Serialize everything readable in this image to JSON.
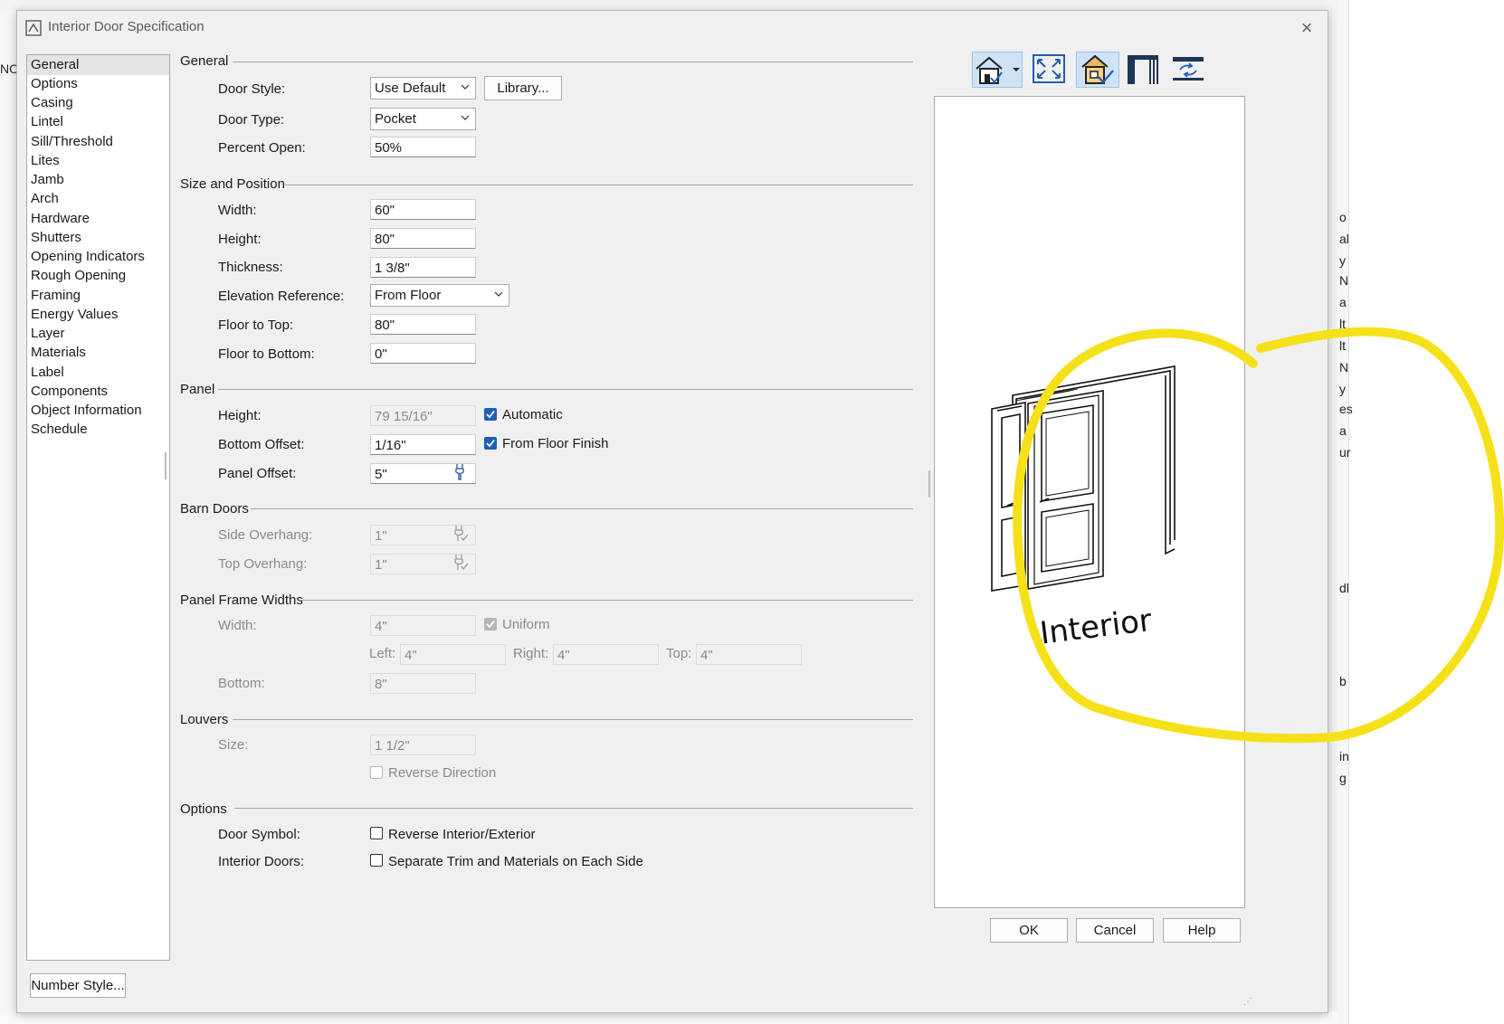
{
  "dialog": {
    "title": "Interior Door Specification",
    "close_glyph": "×"
  },
  "nav": {
    "items": [
      "General",
      "Options",
      "Casing",
      "Lintel",
      "Sill/Threshold",
      "Lites",
      "Jamb",
      "Arch",
      "Hardware",
      "Shutters",
      "Opening Indicators",
      "Rough Opening",
      "Framing",
      "Energy Values",
      "Layer",
      "Materials",
      "Label",
      "Components",
      "Object Information",
      "Schedule"
    ],
    "selected": "General"
  },
  "general": {
    "heading": "General",
    "door_style_label": "Door Style:",
    "door_style_value": "Use Default",
    "library_button": "Library...",
    "door_type_label": "Door Type:",
    "door_type_value": "Pocket",
    "percent_open_label": "Percent Open:",
    "percent_open_value": "50%"
  },
  "size_position": {
    "heading": "Size and Position",
    "width_label": "Width:",
    "width_value": "60\"",
    "height_label": "Height:",
    "height_value": "80\"",
    "thickness_label": "Thickness:",
    "thickness_value": "1 3/8\"",
    "elev_ref_label": "Elevation Reference:",
    "elev_ref_value": "From Floor",
    "floor_top_label": "Floor to Top:",
    "floor_top_value": "80\"",
    "floor_bottom_label": "Floor to Bottom:",
    "floor_bottom_value": "0\""
  },
  "panel": {
    "heading": "Panel",
    "height_label": "Height:",
    "height_value": "79 15/16\"",
    "automatic_label": "Automatic",
    "automatic_checked": true,
    "bottom_offset_label": "Bottom Offset:",
    "bottom_offset_value": "1/16\"",
    "from_floor_finish_label": "From Floor Finish",
    "from_floor_finish_checked": true,
    "panel_offset_label": "Panel Offset:",
    "panel_offset_value": "5\""
  },
  "barn_doors": {
    "heading": "Barn Doors",
    "side_overhang_label": "Side Overhang:",
    "side_overhang_value": "1\"",
    "top_overhang_label": "Top Overhang:",
    "top_overhang_value": "1\""
  },
  "panel_frame": {
    "heading": "Panel Frame Widths",
    "width_label": "Width:",
    "width_value": "4\"",
    "uniform_label": "Uniform",
    "uniform_checked": true,
    "left_label": "Left:",
    "left_value": "4\"",
    "right_label": "Right:",
    "right_value": "4\"",
    "top_label": "Top:",
    "top_value": "4\"",
    "bottom_label": "Bottom:",
    "bottom_value": "8\""
  },
  "louvers": {
    "heading": "Louvers",
    "size_label": "Size:",
    "size_value": "1 1/2\"",
    "reverse_label": "Reverse Direction",
    "reverse_checked": false
  },
  "options": {
    "heading": "Options",
    "door_symbol_label": "Door Symbol:",
    "reverse_int_ext_label": "Reverse Interior/Exterior",
    "reverse_int_ext_checked": false,
    "interior_doors_label": "Interior Doors:",
    "separate_trim_label": "Separate Trim and Materials on Each Side",
    "separate_trim_checked": false
  },
  "preview": {
    "caption": "Interior",
    "annotation_color": "#f5e11a",
    "toolbar_icons": [
      "house-view-icon",
      "fill-window-icon",
      "house-check-icon",
      "door-frame-icon",
      "swap-icon"
    ]
  },
  "footer": {
    "number_style_button": "Number Style...",
    "ok_button": "OK",
    "cancel_button": "Cancel",
    "help_button": "Help"
  },
  "background_fragments": [
    "NO",
    "o",
    "al",
    "y",
    "N",
    "a",
    "lt",
    "lt",
    "N",
    "y",
    "es",
    "a",
    "ur",
    "dl",
    "b",
    "in",
    "g"
  ],
  "colors": {
    "accent": "#1f5fb5",
    "dialog_bg": "#f0f0f0",
    "selection": "#e4e4e4"
  }
}
